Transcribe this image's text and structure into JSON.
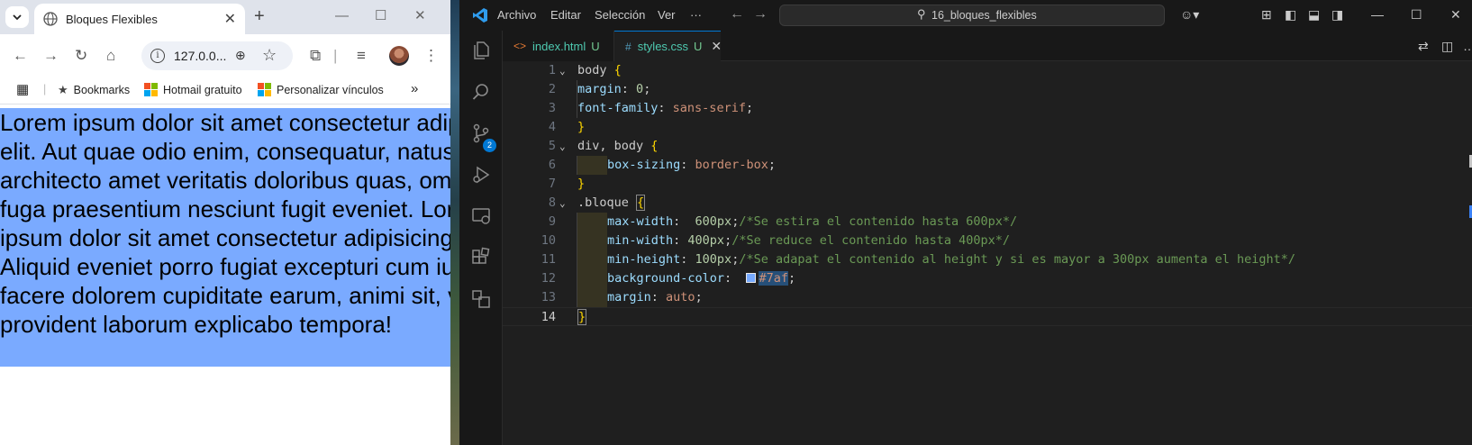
{
  "browser": {
    "tab_title": "Bloques Flexibles",
    "address": "127.0.0...",
    "bookmarks": [
      {
        "label": "Bookmarks"
      },
      {
        "label": "Hotmail gratuito"
      },
      {
        "label": "Personalizar vínculos"
      }
    ],
    "page_text": "Lorem ipsum dolor sit amet consectetur adipisicing elit. Aut quae odio enim, consequatur, natus quae architecto amet veritatis doloribus quas, omnis dicta fuga praesentium nesciunt fugit eveniet. Lorem ipsum dolor sit amet consectetur adipisicing elit. Aliquid eveniet porro fugiat excepturi cum iusto facere dolorem cupiditate earum, animi sit, veniam provident laborum explicabo tempora!",
    "block_color": "#7aaaff"
  },
  "vscode": {
    "menu": [
      "Archivo",
      "Editar",
      "Selección",
      "Ver",
      "···"
    ],
    "search_text": "16_bloques_flexibles",
    "scm_badge": "2",
    "tabs": [
      {
        "icon": "<>",
        "name": "index.html",
        "status": "U",
        "active": false
      },
      {
        "icon": "#",
        "name": "styles.css",
        "status": "U",
        "active": true
      }
    ],
    "code_lines": [
      {
        "n": "1",
        "tokens": [
          [
            "sel",
            "body "
          ],
          [
            "br",
            "{"
          ]
        ]
      },
      {
        "n": "2",
        "tokens": [
          [
            "prop",
            "margin"
          ],
          [
            "pun",
            ": "
          ],
          [
            "num",
            "0"
          ],
          [
            "pun",
            ";"
          ]
        ]
      },
      {
        "n": "3",
        "tokens": [
          [
            "prop",
            "font-family"
          ],
          [
            "pun",
            ": "
          ],
          [
            "val",
            "sans-serif"
          ],
          [
            "pun",
            ";"
          ]
        ]
      },
      {
        "n": "4",
        "tokens": [
          [
            "br",
            "}"
          ]
        ]
      },
      {
        "n": "5",
        "tokens": [
          [
            "sel",
            "div, body "
          ],
          [
            "br",
            "{"
          ]
        ]
      },
      {
        "n": "6",
        "tokens": [
          [
            "prop",
            "box-sizing"
          ],
          [
            "pun",
            ": "
          ],
          [
            "val",
            "border-box"
          ],
          [
            "pun",
            ";"
          ]
        ]
      },
      {
        "n": "7",
        "tokens": [
          [
            "br",
            "}"
          ]
        ]
      },
      {
        "n": "8",
        "tokens": [
          [
            "sel",
            ".bloque "
          ],
          [
            "brH",
            "{"
          ]
        ]
      },
      {
        "n": "9",
        "tokens": [
          [
            "prop",
            "max-width"
          ],
          [
            "pun",
            ":  "
          ],
          [
            "num",
            "600px"
          ],
          [
            "pun",
            ";"
          ],
          [
            "com",
            "/*Se estira el contenido hasta 600px*/"
          ]
        ]
      },
      {
        "n": "10",
        "tokens": [
          [
            "prop",
            "min-width"
          ],
          [
            "pun",
            ": "
          ],
          [
            "num",
            "400px"
          ],
          [
            "pun",
            ";"
          ],
          [
            "com",
            "/*Se reduce el contenido hasta 400px*/"
          ]
        ]
      },
      {
        "n": "11",
        "tokens": [
          [
            "prop",
            "min-height"
          ],
          [
            "pun",
            ": "
          ],
          [
            "num",
            "100px"
          ],
          [
            "pun",
            ";"
          ],
          [
            "com",
            "/*Se adapat el contenido al height y si es mayor a 300px aumenta el height*/"
          ]
        ]
      },
      {
        "n": "12",
        "tokens": [
          [
            "prop",
            "background-color"
          ],
          [
            "pun",
            ":  "
          ],
          [
            "hex",
            "#7af"
          ],
          [
            "pun",
            ";"
          ]
        ]
      },
      {
        "n": "13",
        "tokens": [
          [
            "prop",
            "margin"
          ],
          [
            "pun",
            ": "
          ],
          [
            "val",
            "auto"
          ],
          [
            "pun",
            ";"
          ]
        ]
      },
      {
        "n": "14",
        "tokens": [
          [
            "brH",
            "}"
          ]
        ]
      }
    ],
    "swatch_color": "#77aaff"
  }
}
